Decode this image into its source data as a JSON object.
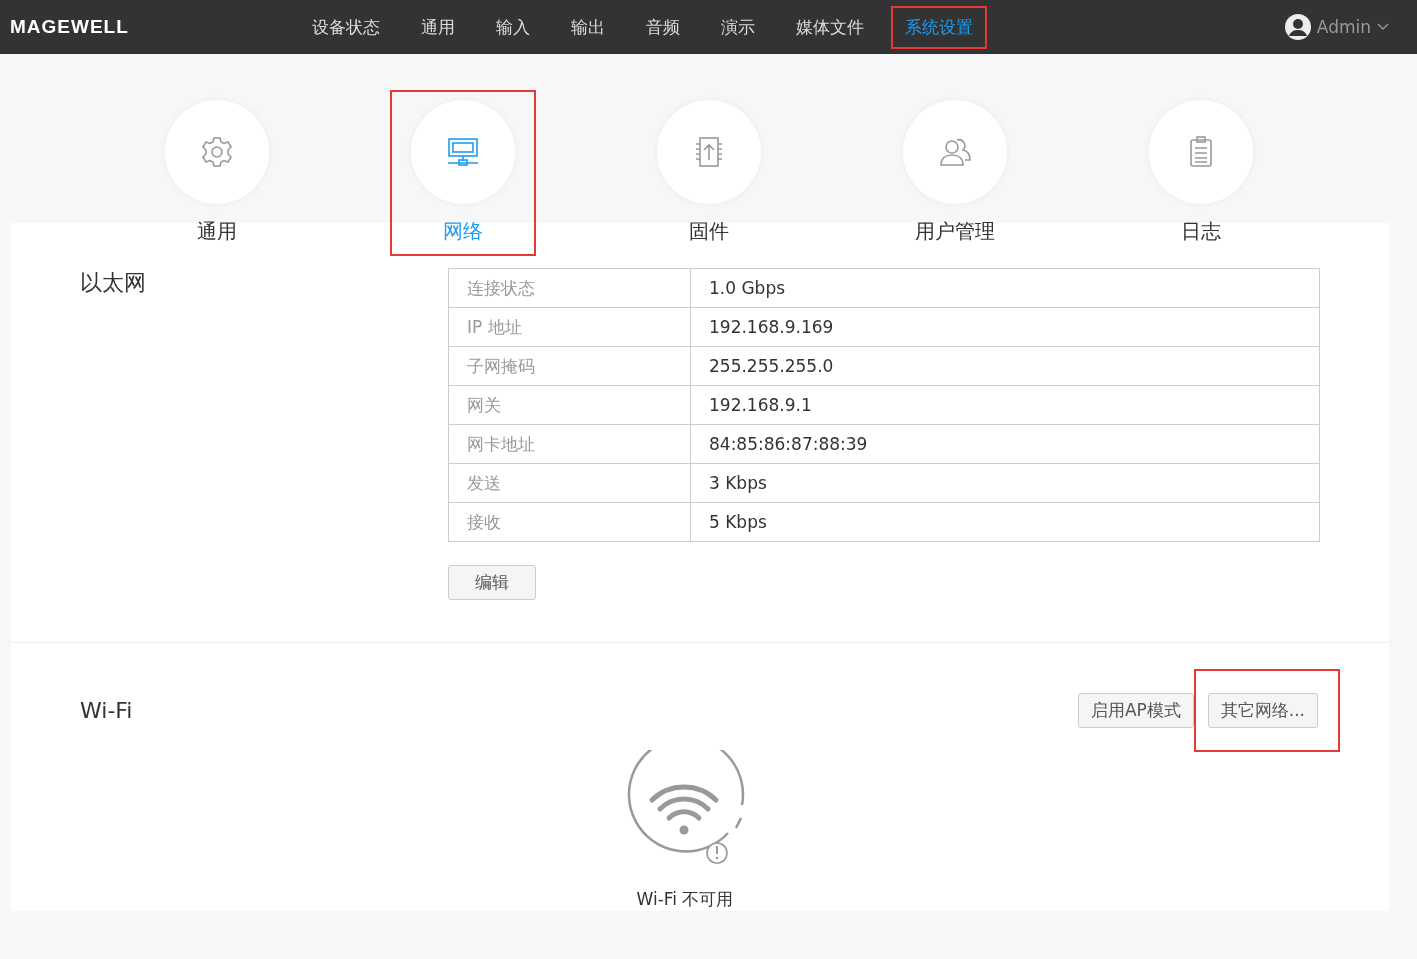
{
  "header": {
    "logo": "MAGEWELL",
    "nav": [
      {
        "label": "设备状态",
        "selected": false,
        "highlighted": false
      },
      {
        "label": "通用",
        "selected": false,
        "highlighted": false
      },
      {
        "label": "输入",
        "selected": false,
        "highlighted": false
      },
      {
        "label": "输出",
        "selected": false,
        "highlighted": false
      },
      {
        "label": "音频",
        "selected": false,
        "highlighted": false
      },
      {
        "label": "演示",
        "selected": false,
        "highlighted": false
      },
      {
        "label": "媒体文件",
        "selected": false,
        "highlighted": false
      },
      {
        "label": "系统设置",
        "selected": true,
        "highlighted": true
      }
    ],
    "user": "Admin"
  },
  "categories": [
    {
      "kind": "gear",
      "label": "通用",
      "selected": false,
      "highlighted": false
    },
    {
      "kind": "network",
      "label": "网络",
      "selected": true,
      "highlighted": true
    },
    {
      "kind": "firmware",
      "label": "固件",
      "selected": false,
      "highlighted": false
    },
    {
      "kind": "users",
      "label": "用户管理",
      "selected": false,
      "highlighted": false
    },
    {
      "kind": "log",
      "label": "日志",
      "selected": false,
      "highlighted": false
    }
  ],
  "ethernet": {
    "title": "以太网",
    "rows": [
      {
        "label": "连接状态",
        "value": "1.0 Gbps"
      },
      {
        "label": "IP 地址",
        "value": "192.168.9.169"
      },
      {
        "label": "子网掩码",
        "value": "255.255.255.0"
      },
      {
        "label": "网关",
        "value": "192.168.9.1"
      },
      {
        "label": "网卡地址",
        "value": "84:85:86:87:88:39"
      },
      {
        "label": "发送",
        "value": "3 Kbps"
      },
      {
        "label": "接收",
        "value": "5 Kbps"
      }
    ],
    "edit_button": "编辑"
  },
  "wifi": {
    "title": "Wi-Fi",
    "buttons": [
      {
        "label": "启用AP模式",
        "highlighted": false
      },
      {
        "label": "其它网络...",
        "highlighted": true
      }
    ],
    "status": "Wi-Fi 不可用"
  }
}
